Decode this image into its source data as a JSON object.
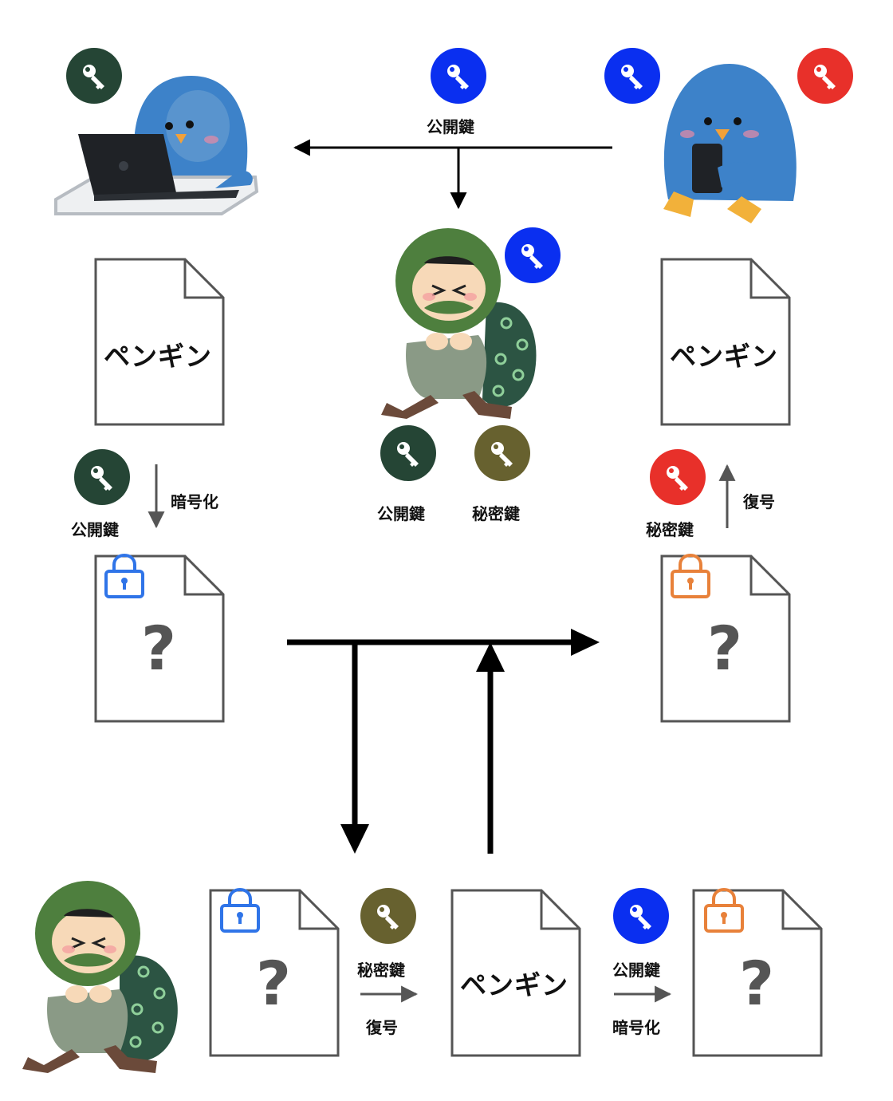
{
  "colors": {
    "public_key_blue": "#0a2ff0",
    "private_key_red": "#e8302a",
    "public_key_dark_green": "#254535",
    "private_key_olive": "#67612f",
    "lock_blue": "#2f74e8",
    "lock_orange": "#e8813a",
    "penguin_blue": "#3d82c9",
    "thief_hood_green": "#4e7f3e"
  },
  "labels": {
    "public_key": "公開鍵",
    "private_key": "秘密鍵",
    "encrypt": "暗号化",
    "decrypt": "復号"
  },
  "document_text": "ペンギン",
  "encrypted_symbol": "?"
}
